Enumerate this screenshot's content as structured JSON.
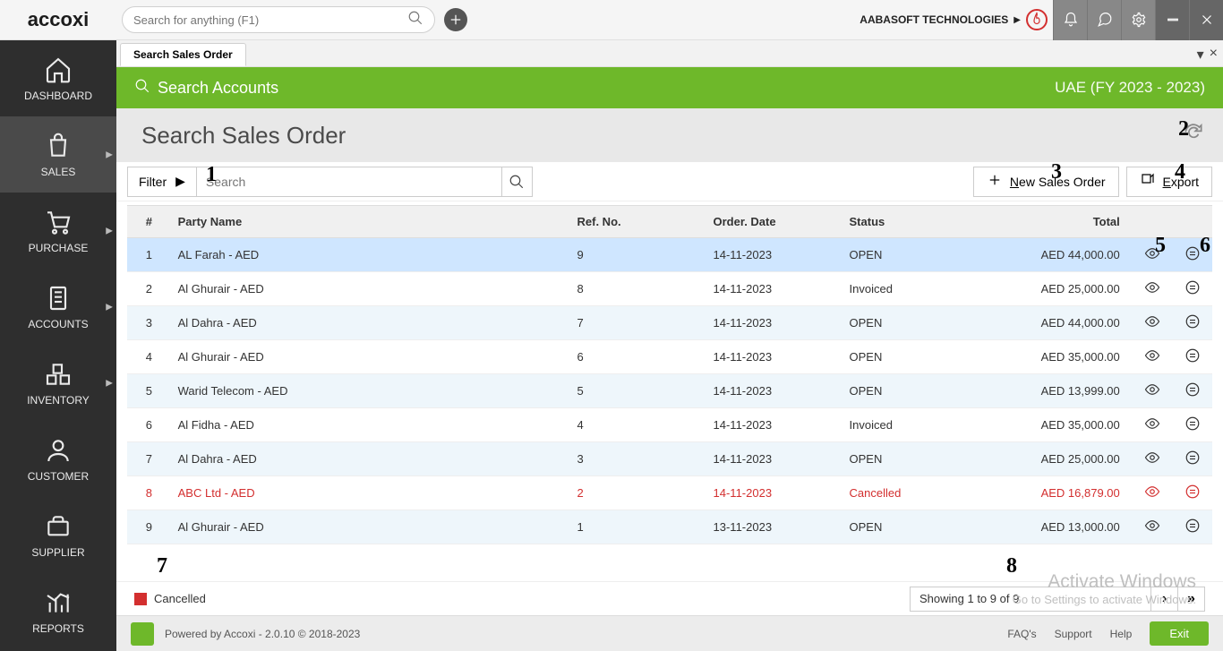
{
  "logo": "accoxi",
  "top_search_placeholder": "Search for anything (F1)",
  "company_name": "AABASOFT TECHNOLOGIES",
  "sidebar": [
    {
      "label": "DASHBOARD",
      "has_caret": false
    },
    {
      "label": "SALES",
      "has_caret": true
    },
    {
      "label": "PURCHASE",
      "has_caret": true
    },
    {
      "label": "ACCOUNTS",
      "has_caret": true
    },
    {
      "label": "INVENTORY",
      "has_caret": true
    },
    {
      "label": "CUSTOMER",
      "has_caret": false
    },
    {
      "label": "SUPPLIER",
      "has_caret": false
    },
    {
      "label": "REPORTS",
      "has_caret": false
    }
  ],
  "tab_label": "Search Sales Order",
  "green_title": "Search Accounts",
  "fiscal_year": "UAE (FY 2023 - 2023)",
  "page_title": "Search Sales Order",
  "filter_label": "Filter",
  "toolbar_search_placeholder": "Search",
  "new_btn": "New Sales Order",
  "export_btn": "Export",
  "table": {
    "headers": {
      "num": "#",
      "party": "Party Name",
      "ref": "Ref. No.",
      "date": "Order. Date",
      "status": "Status",
      "total": "Total"
    },
    "rows": [
      {
        "n": "1",
        "party": "AL Farah - AED",
        "ref": "9",
        "date": "14-11-2023",
        "status": "OPEN",
        "total": "AED 44,000.00",
        "sel": true,
        "alt": false,
        "cancelled": false
      },
      {
        "n": "2",
        "party": "Al Ghurair - AED",
        "ref": "8",
        "date": "14-11-2023",
        "status": "Invoiced",
        "total": "AED 25,000.00",
        "sel": false,
        "alt": false,
        "cancelled": false
      },
      {
        "n": "3",
        "party": "Al Dahra - AED",
        "ref": "7",
        "date": "14-11-2023",
        "status": "OPEN",
        "total": "AED 44,000.00",
        "sel": false,
        "alt": true,
        "cancelled": false
      },
      {
        "n": "4",
        "party": "Al Ghurair - AED",
        "ref": "6",
        "date": "14-11-2023",
        "status": "OPEN",
        "total": "AED 35,000.00",
        "sel": false,
        "alt": false,
        "cancelled": false
      },
      {
        "n": "5",
        "party": "Warid Telecom - AED",
        "ref": "5",
        "date": "14-11-2023",
        "status": "OPEN",
        "total": "AED 13,999.00",
        "sel": false,
        "alt": true,
        "cancelled": false
      },
      {
        "n": "6",
        "party": "Al Fidha - AED",
        "ref": "4",
        "date": "14-11-2023",
        "status": "Invoiced",
        "total": "AED 35,000.00",
        "sel": false,
        "alt": false,
        "cancelled": false
      },
      {
        "n": "7",
        "party": "Al Dahra - AED",
        "ref": "3",
        "date": "14-11-2023",
        "status": "OPEN",
        "total": "AED 25,000.00",
        "sel": false,
        "alt": true,
        "cancelled": false
      },
      {
        "n": "8",
        "party": "ABC Ltd - AED",
        "ref": "2",
        "date": "14-11-2023",
        "status": "Cancelled",
        "total": "AED 16,879.00",
        "sel": false,
        "alt": false,
        "cancelled": true
      },
      {
        "n": "9",
        "party": "Al Ghurair - AED",
        "ref": "1",
        "date": "13-11-2023",
        "status": "OPEN",
        "total": "AED 13,000.00",
        "sel": false,
        "alt": true,
        "cancelled": false
      }
    ]
  },
  "legend_label": "Cancelled",
  "pager_text": "Showing 1 to 9 of 9",
  "footer_text": "Powered by Accoxi - 2.0.10 © 2018-2023",
  "footer_links": [
    "FAQ's",
    "Support",
    "Help"
  ],
  "exit_label": "Exit",
  "watermark_title": "Activate Windows",
  "watermark_sub": "Go to Settings to activate Windows.",
  "annotations": {
    "a1": "1",
    "a2": "2",
    "a3": "3",
    "a4": "4",
    "a5": "5",
    "a6": "6",
    "a7": "7",
    "a8": "8"
  }
}
